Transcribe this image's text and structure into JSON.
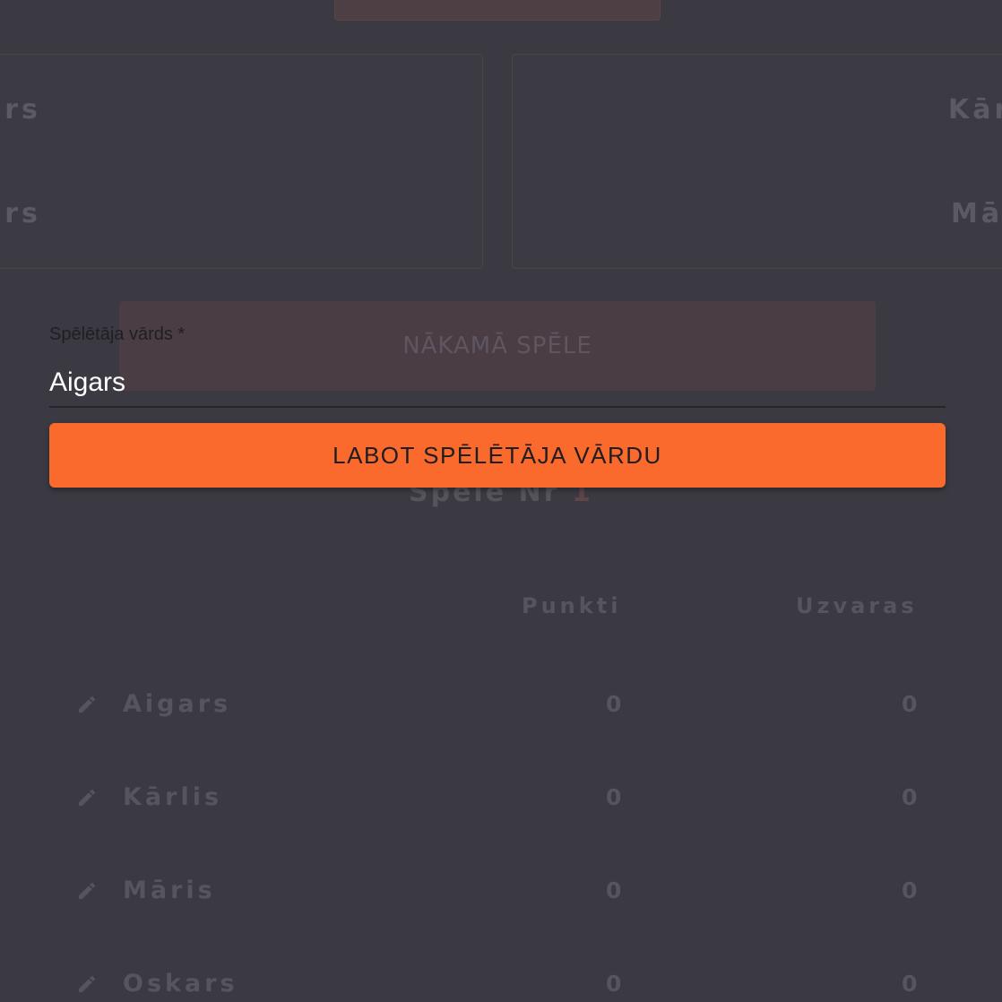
{
  "background_game": {
    "left_card": {
      "line1": "ars",
      "line2": "ars"
    },
    "right_card": {
      "line1": "Kār",
      "line2": "Mā"
    },
    "next_game_label": "NĀKAMĀ SPĒLE",
    "game_number_label": "Spēle Nr",
    "game_number_value": "1",
    "table": {
      "headers": {
        "points": "Punkti",
        "wins": "Uzvaras"
      },
      "rows": [
        {
          "name": "Aigars",
          "points": "0",
          "wins": "0"
        },
        {
          "name": "Kārlis",
          "points": "0",
          "wins": "0"
        },
        {
          "name": "Māris",
          "points": "0",
          "wins": "0"
        },
        {
          "name": "Oskars",
          "points": "0",
          "wins": "0"
        }
      ]
    }
  },
  "dialog": {
    "field_label": "Spēlētāja vārds *",
    "field_value": "Aigars",
    "submit_label": "LABOT SPĒLĒTĀJA VĀRDU"
  },
  "colors": {
    "background": "#3b3a43",
    "accent": "#fa6a2c"
  }
}
